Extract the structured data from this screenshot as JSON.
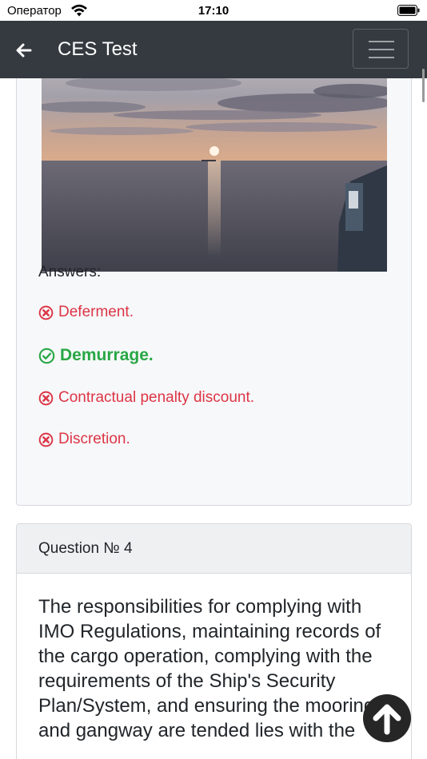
{
  "status_bar": {
    "carrier": "Оператор",
    "time": "17:10"
  },
  "header": {
    "title": "CES Test",
    "back_icon": "arrow-left-icon",
    "menu_icon": "hamburger-menu-icon"
  },
  "question_3": {
    "answers_label": "Answers:",
    "answers": [
      {
        "text": "Deferment.",
        "status": "wrong"
      },
      {
        "text": "Demurrage.",
        "status": "correct"
      },
      {
        "text": "Contractual penalty discount.",
        "status": "wrong"
      },
      {
        "text": "Discretion.",
        "status": "wrong"
      }
    ]
  },
  "question_4": {
    "header": "Question № 4",
    "text": "The responsibilities for complying with IMO Regulations, maintaining records of the cargo operation, complying with the requirements of the Ship's Security Plan/System, and ensuring the moorings and gangway are tended lies with the"
  },
  "colors": {
    "navbar": "#343a40",
    "wrong": "#dc3545",
    "correct": "#28a745"
  }
}
